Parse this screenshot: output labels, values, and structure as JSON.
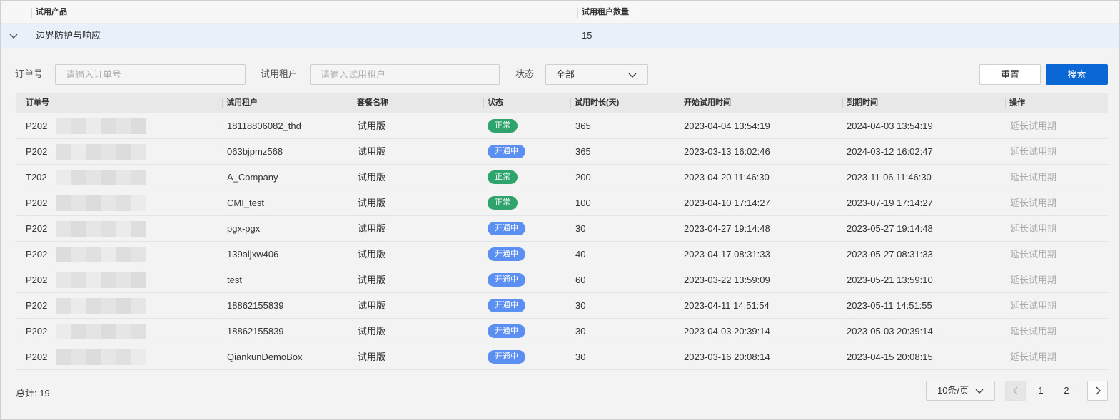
{
  "outer_table": {
    "columns": [
      "试用产品",
      "试用租户数量"
    ],
    "row": {
      "product": "边界防护与响应",
      "tenant_count": "15"
    }
  },
  "filters": {
    "order_label": "订单号",
    "order_placeholder": "请输入订单号",
    "tenant_label": "试用租户",
    "tenant_placeholder": "请输入试用租户",
    "status_label": "状态",
    "status_value": "全部",
    "reset_label": "重置",
    "search_label": "搜索"
  },
  "table": {
    "columns": [
      "订单号",
      "试用租户",
      "套餐名称",
      "状态",
      "试用时长(天)",
      "开始试用时间",
      "到期时间",
      "操作"
    ],
    "rows": [
      {
        "order": "P202",
        "tenant": "18118806082_thd",
        "plan": "试用版",
        "status": "正常",
        "status_type": "ok",
        "days": "365",
        "start": "2023-04-04 13:54:19",
        "end": "2024-04-03 13:54:19",
        "action": "延长试用期"
      },
      {
        "order": "P202",
        "tenant": "063bjpmz568",
        "plan": "试用版",
        "status": "开通中",
        "status_type": "opening",
        "days": "365",
        "start": "2023-03-13 16:02:46",
        "end": "2024-03-12 16:02:47",
        "action": "延长试用期"
      },
      {
        "order": "T202",
        "tenant": "A_Company",
        "plan": "试用版",
        "status": "正常",
        "status_type": "ok",
        "days": "200",
        "start": "2023-04-20 11:46:30",
        "end": "2023-11-06 11:46:30",
        "action": "延长试用期"
      },
      {
        "order": "P202",
        "tenant": "CMI_test",
        "plan": "试用版",
        "status": "正常",
        "status_type": "ok",
        "days": "100",
        "start": "2023-04-10 17:14:27",
        "end": "2023-07-19 17:14:27",
        "action": "延长试用期"
      },
      {
        "order": "P202",
        "tenant": "pgx-pgx",
        "plan": "试用版",
        "status": "开通中",
        "status_type": "opening",
        "days": "30",
        "start": "2023-04-27 19:14:48",
        "end": "2023-05-27 19:14:48",
        "action": "延长试用期"
      },
      {
        "order": "P202",
        "tenant": "139aljxw406",
        "plan": "试用版",
        "status": "开通中",
        "status_type": "opening",
        "days": "40",
        "start": "2023-04-17 08:31:33",
        "end": "2023-05-27 08:31:33",
        "action": "延长试用期"
      },
      {
        "order": "P202",
        "tenant": "test",
        "plan": "试用版",
        "status": "开通中",
        "status_type": "opening",
        "days": "60",
        "start": "2023-03-22 13:59:09",
        "end": "2023-05-21 13:59:10",
        "action": "延长试用期"
      },
      {
        "order": "P202",
        "tenant": "18862155839",
        "plan": "试用版",
        "status": "开通中",
        "status_type": "opening",
        "days": "30",
        "start": "2023-04-11 14:51:54",
        "end": "2023-05-11 14:51:55",
        "action": "延长试用期"
      },
      {
        "order": "P202",
        "tenant": "18862155839",
        "plan": "试用版",
        "status": "开通中",
        "status_type": "opening",
        "days": "30",
        "start": "2023-04-03 20:39:14",
        "end": "2023-05-03 20:39:14",
        "action": "延长试用期"
      },
      {
        "order": "P202",
        "tenant": "QiankunDemoBox",
        "plan": "试用版",
        "status": "开通中",
        "status_type": "opening",
        "days": "30",
        "start": "2023-03-16 20:08:14",
        "end": "2023-04-15 20:08:15",
        "action": "延长试用期"
      }
    ]
  },
  "footer": {
    "total_label": "总计: 19",
    "page_size": "10条/页",
    "pages": [
      "1",
      "2"
    ]
  },
  "colors": {
    "primary": "#0a67d4",
    "status_ok": "#2ea36c",
    "status_opening": "#5b8ff2",
    "row_highlight": "#e8f0fa",
    "action_text": "#a9a9a9"
  }
}
